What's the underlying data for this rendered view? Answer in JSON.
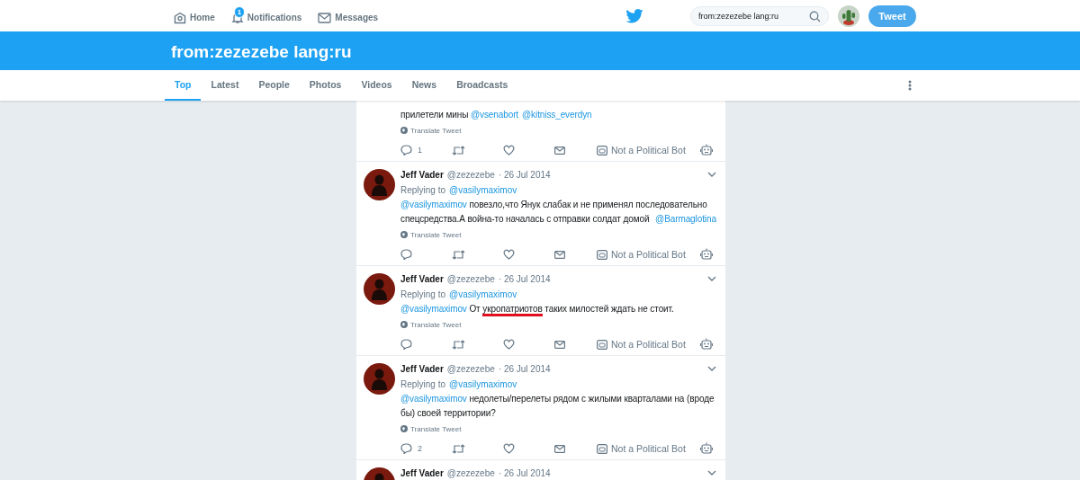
{
  "nav": {
    "items": [
      {
        "label": "Home",
        "selected": false
      },
      {
        "label": "Notifications",
        "badge": "1",
        "selected": false
      },
      {
        "label": "Messages",
        "selected": false
      }
    ],
    "search": {
      "value": "from:zezezebe lang:ru"
    },
    "tweet_button": "Tweet"
  },
  "header": {
    "title": "from:zezezebe lang:ru"
  },
  "tabs": [
    {
      "label": "Top",
      "selected": true
    },
    {
      "label": "Latest",
      "selected": false
    },
    {
      "label": "People",
      "selected": false
    },
    {
      "label": "Photos",
      "selected": false
    },
    {
      "label": "Videos",
      "selected": false
    },
    {
      "label": "News",
      "selected": false
    },
    {
      "label": "Broadcasts",
      "selected": false
    }
  ],
  "tweets": [
    {
      "body": [
        {
          "kind": "plain",
          "text": "прилетели мины "
        },
        {
          "kind": "mention",
          "text": "@vsenabort"
        },
        {
          "kind": "mention",
          "text": "@kitniss_everdyn"
        }
      ],
      "translate": "Translate Tweet",
      "replies": "1",
      "bot_label": "Not a Political Bot"
    },
    {
      "author": "Jeff Vader",
      "handle": "@zezezebe",
      "time": "· 26 Jul 2014",
      "replying_label": "Replying to",
      "replying_to": "@vasilymaximov",
      "body": [
        {
          "kind": "mention",
          "text": "@vasilymaximov"
        },
        {
          "kind": "plain",
          "text": " повезло,что Янук слабак и не применял последовательно спецсредства.А война-то началась с отправки солдат домой "
        },
        {
          "kind": "mention",
          "text": "@Barmaglotina"
        }
      ],
      "translate": "Translate Tweet",
      "bot_label": "Not a Political Bot"
    },
    {
      "author": "Jeff Vader",
      "handle": "@zezezebe",
      "time": "· 26 Jul 2014",
      "replying_label": "Replying to",
      "replying_to": "@vasilymaximov",
      "body": [
        {
          "kind": "mention",
          "text": "@vasilymaximov"
        },
        {
          "kind": "plain",
          "text": " От "
        },
        {
          "kind": "underlined",
          "text": "укропатриотов"
        },
        {
          "kind": "plain",
          "text": " таких милостей ждать не стоит."
        }
      ],
      "translate": "Translate Tweet",
      "bot_label": "Not a Political Bot"
    },
    {
      "author": "Jeff Vader",
      "handle": "@zezezebe",
      "time": "· 26 Jul 2014",
      "replying_label": "Replying to",
      "replying_to": "@vasilymaximov",
      "body": [
        {
          "kind": "mention",
          "text": "@vasilymaximov"
        },
        {
          "kind": "plain",
          "text": " недолеты/перелеты рядом с жилыми кварталами на (вроде бы) своей территории?"
        }
      ],
      "translate": "Translate Tweet",
      "replies": "2",
      "bot_label": "Not a Political Bot"
    },
    {
      "author": "Jeff Vader",
      "handle": "@zezezebe",
      "time": "· 26 Jul 2014"
    }
  ]
}
